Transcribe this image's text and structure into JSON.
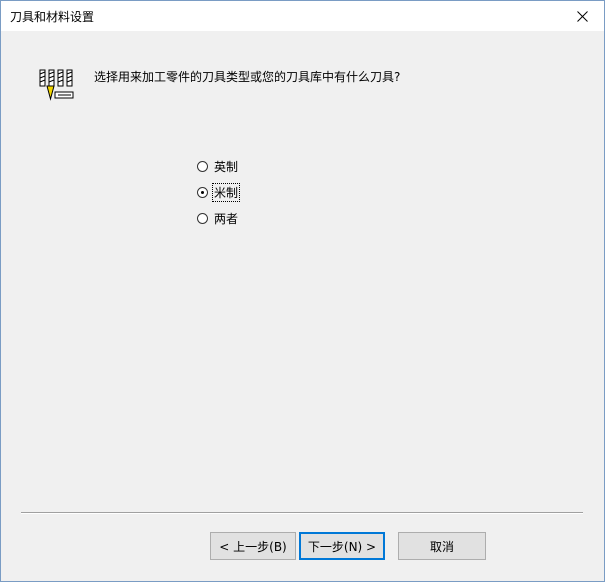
{
  "window": {
    "title": "刀具和材料设置"
  },
  "prompt": {
    "text": "选择用来加工零件的刀具类型或您的刀具库中有什么刀具?"
  },
  "units": {
    "options": [
      {
        "label": "英制",
        "checked": false
      },
      {
        "label": "米制",
        "checked": true
      },
      {
        "label": "两者",
        "checked": false
      }
    ]
  },
  "buttons": {
    "back_label": "< 上一步(B)",
    "next_label": "下一步(N) >",
    "cancel_label": "取消"
  },
  "icons": {
    "header": "tool-mill-icon",
    "close": "close-icon"
  }
}
